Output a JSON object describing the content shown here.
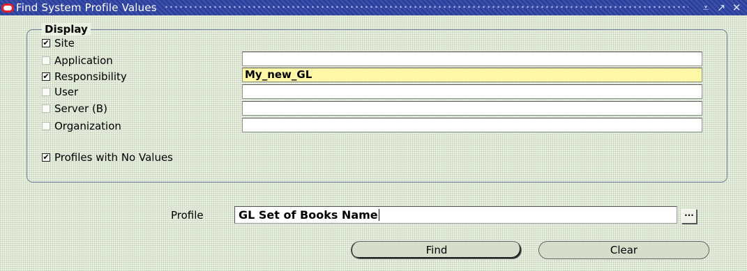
{
  "window": {
    "title": "Find System Profile Values",
    "minimize_glyph": "⩡",
    "maximize_glyph": "↗",
    "close_glyph": "✕"
  },
  "display_group": {
    "legend": "Display",
    "site": {
      "label": "Site",
      "checked": true
    },
    "rows": [
      {
        "key": "application",
        "label": "Application",
        "checked": false,
        "value": ""
      },
      {
        "key": "responsibility",
        "label": "Responsibility",
        "checked": true,
        "value": "My_new_GL"
      },
      {
        "key": "user",
        "label": "User",
        "checked": false,
        "value": ""
      },
      {
        "key": "server",
        "label": "Server (B)",
        "checked": false,
        "value": ""
      },
      {
        "key": "organization",
        "label": "Organization",
        "checked": false,
        "value": ""
      }
    ],
    "profiles_no_values": {
      "label": "Profiles with No Values",
      "checked": true
    }
  },
  "profile": {
    "label": "Profile",
    "value": "GL Set of Books Name",
    "lov_glyph": "···"
  },
  "buttons": {
    "find": "Find",
    "clear": "Clear"
  },
  "colors": {
    "titlebar": "#2b3f9e",
    "active_field": "#fff8a6",
    "background": "#eaf0e2"
  }
}
